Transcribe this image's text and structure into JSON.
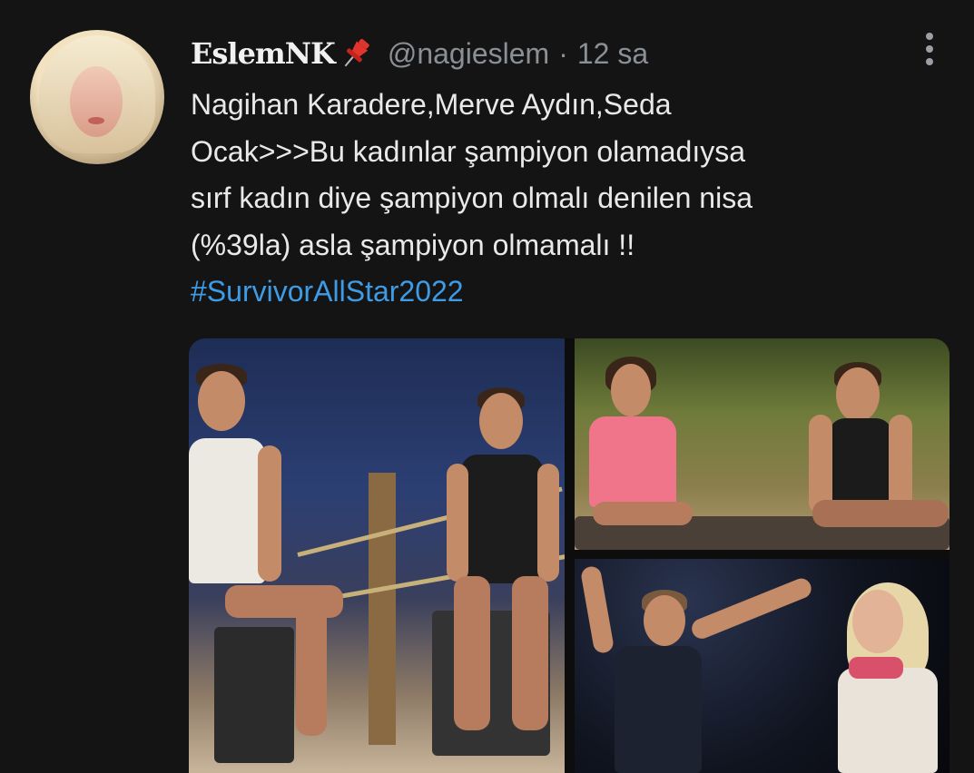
{
  "tweet": {
    "display_name": "EslemNK",
    "handle": "@nagieslem",
    "separator": "·",
    "time": "12 sa",
    "text_lines": [
      "Nagihan Karadere,Merve Aydın,Seda",
      "Ocak>>>Bu kadınlar şampiyon olamadıysa",
      "sırf kadın diye şampiyon olmalı denilen nisa",
      "(%39la) asla şampiyon olmamalı !!"
    ],
    "hashtag": "#SurvivorAllStar2022"
  },
  "icons": {
    "pin": "pushpin-icon",
    "more": "more-vertical-icon"
  },
  "colors": {
    "background": "#141414",
    "text": "#e9e9e9",
    "muted": "#8b9096",
    "link": "#3e9be6",
    "pin": "#e0342c"
  },
  "media": {
    "photo_count": 3
  }
}
